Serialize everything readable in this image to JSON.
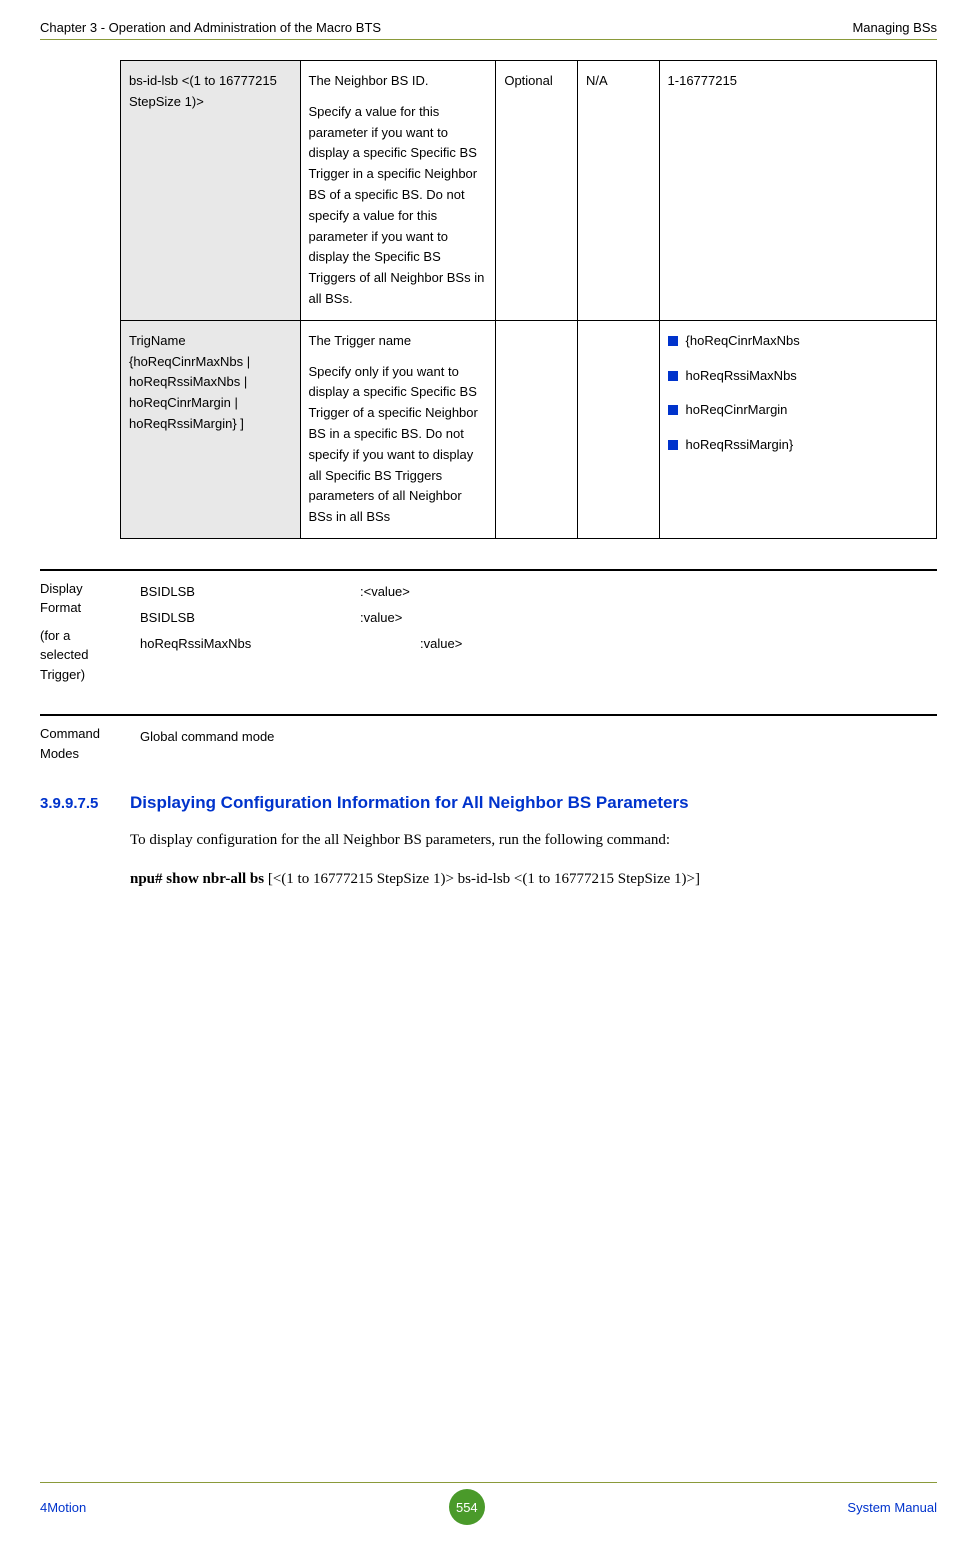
{
  "header": {
    "left": "Chapter 3 - Operation and Administration of the Macro BTS",
    "right": "Managing BSs"
  },
  "table": {
    "rows": [
      {
        "param": "bs-id-lsb <(1 to 16777215 StepSize 1)>",
        "desc_lines": [
          "The Neighbor BS ID.",
          "Specify a value for this parameter if you want to display a specific Specific BS Trigger in a specific Neighbor BS of a specific BS. Do not specify a value for this parameter if you want to display the Specific BS Triggers of all Neighbor BSs in all BSs."
        ],
        "presence": "Optional",
        "default": "N/A",
        "possible_plain": "1-16777215"
      },
      {
        "param": "TrigName {hoReqCinrMaxNbs | hoReqRssiMaxNbs | hoReqCinrMargin | hoReqRssiMargin} ]",
        "desc_lines": [
          "The Trigger name",
          "Specify only if you want to display a specific Specific BS Trigger of a specific Neighbor BS in a specific BS. Do not specify if you want to display all Specific BS Triggers parameters of all Neighbor BSs in all BSs"
        ],
        "presence": "",
        "default": "",
        "possible_bullets": [
          "{hoReqCinrMaxNbs",
          "hoReqRssiMaxNbs",
          "hoReqCinrMargin",
          "hoReqRssiMargin}"
        ]
      }
    ]
  },
  "display_format": {
    "label1": "Display Format",
    "label2": "(for a selected Trigger)",
    "lines": [
      {
        "k": "BSIDLSB",
        "v": ":<value>"
      },
      {
        "k": "BSIDLSB",
        "v": ":value>"
      },
      {
        "k": "hoReqRssiMaxNbs",
        "v": ":value>"
      }
    ]
  },
  "command_modes": {
    "label": "Command Modes",
    "value": "Global command mode"
  },
  "section": {
    "number": "3.9.9.7.5",
    "title": "Displaying Configuration Information for All Neighbor BS Parameters",
    "para1": "To display configuration for the all Neighbor BS parameters, run the following command:",
    "cmd_bold": "npu# show nbr-all bs",
    "cmd_rest": " [<(1 to 16777215 StepSize 1)> bs-id-lsb <(1 to 16777215 StepSize 1)>]"
  },
  "footer": {
    "left": "4Motion",
    "page": "554",
    "right": "System Manual"
  }
}
